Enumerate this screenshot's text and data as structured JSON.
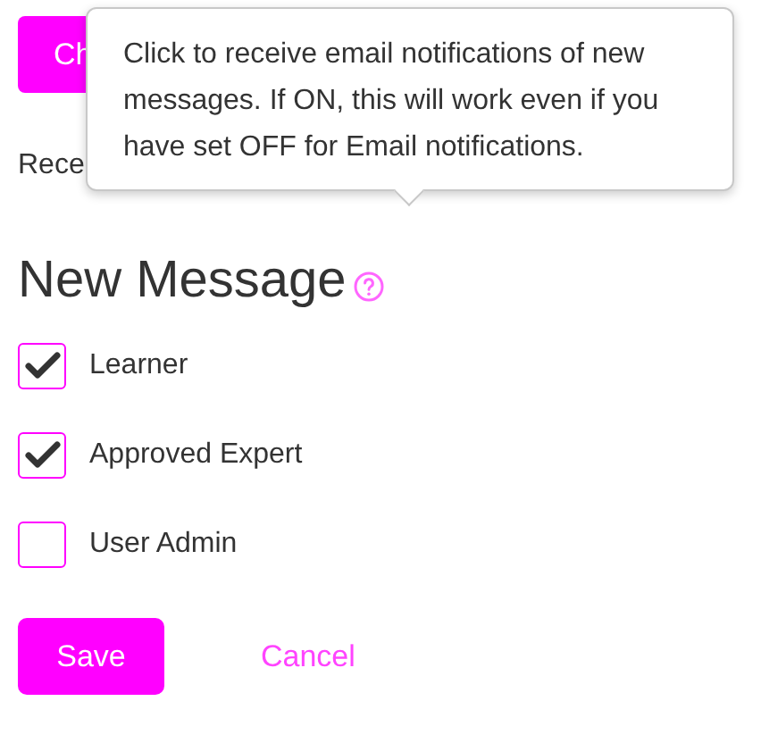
{
  "top_button": {
    "label": "Ch"
  },
  "receive_text": "Rece",
  "tooltip": {
    "text": "Click to receive email notifications of new messages. If ON, this will work even if you have set OFF for Email notifications."
  },
  "heading": "New Message",
  "options": [
    {
      "label": "Learner",
      "checked": true
    },
    {
      "label": "Approved Expert",
      "checked": true
    },
    {
      "label": "User Admin",
      "checked": false
    }
  ],
  "buttons": {
    "save": "Save",
    "cancel": "Cancel"
  }
}
